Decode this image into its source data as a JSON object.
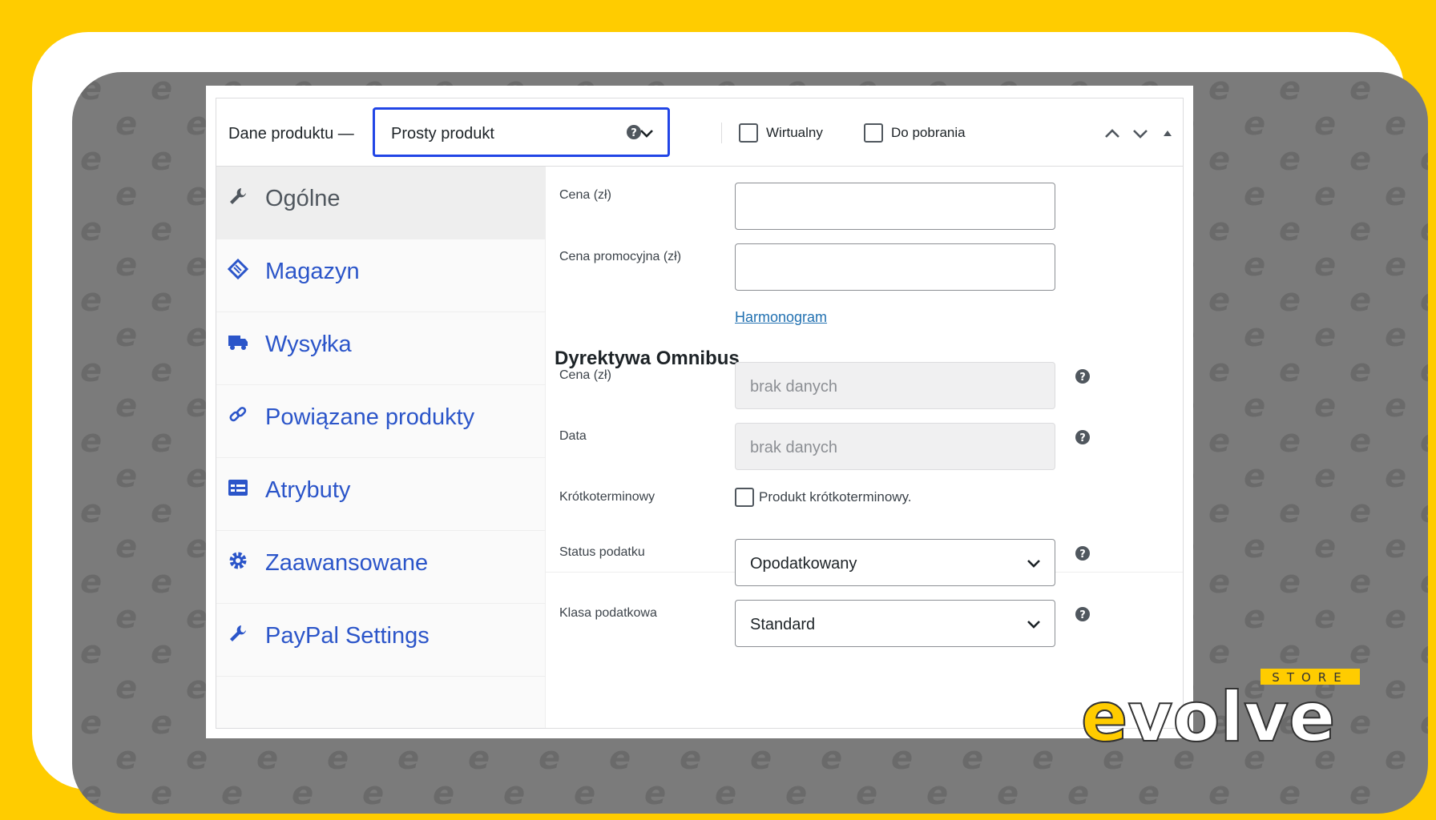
{
  "header": {
    "title": "Dane produktu —",
    "product_type": "Prosty produkt",
    "virtual_label": "Wirtualny",
    "download_label": "Do pobrania"
  },
  "tabs": [
    {
      "label": "Ogólne",
      "icon": "wrench-icon",
      "active": true
    },
    {
      "label": "Magazyn",
      "icon": "tag-icon"
    },
    {
      "label": "Wysyłka",
      "icon": "truck-icon"
    },
    {
      "label": "Powiązane produkty",
      "icon": "link-icon"
    },
    {
      "label": "Atrybuty",
      "icon": "list-icon"
    },
    {
      "label": "Zaawansowane",
      "icon": "gear-icon"
    },
    {
      "label": "PayPal Settings",
      "icon": "wrench-icon"
    }
  ],
  "general": {
    "price_label": "Cena (zł)",
    "price_value": "",
    "sale_price_label": "Cena promocyjna (zł)",
    "sale_price_value": "",
    "schedule_link": "Harmonogram",
    "omnibus_title": "Dyrektywa Omnibus",
    "omnibus_price_label": "Cena (zł)",
    "omnibus_price_value": "brak danych",
    "omnibus_date_label": "Data",
    "omnibus_date_value": "brak danych",
    "short_term_label": "Krótkoterminowy",
    "short_term_checkbox": "Produkt krótkoterminowy.",
    "tax_status_label": "Status podatku",
    "tax_status_value": "Opodatkowany",
    "tax_class_label": "Klasa podatkowa",
    "tax_class_value": "Standard"
  },
  "brand": {
    "logo_text": "evolve",
    "logo_sub": "STORE",
    "accent": "#ffcc00",
    "link_color": "#2b55c9",
    "focus_color": "#2145e6"
  }
}
